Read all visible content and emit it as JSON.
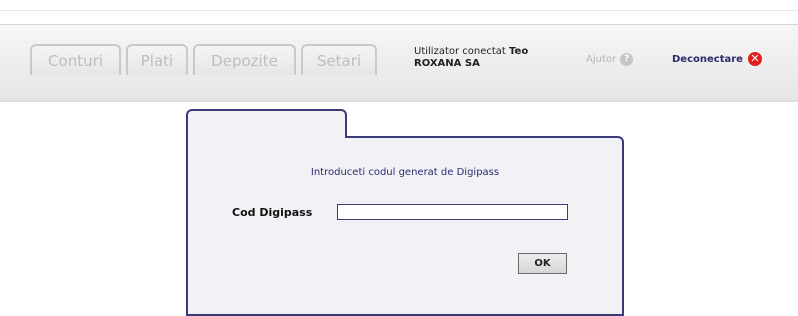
{
  "header": {
    "tabs": [
      {
        "label": "Conturi"
      },
      {
        "label": "Plati"
      },
      {
        "label": "Depozite"
      },
      {
        "label": "Setari"
      }
    ],
    "user_prefix": "Utilizator conectat",
    "user_name": "Teo",
    "user_company": "ROXANA SA",
    "help_label": "Ajutor",
    "help_icon": "help-icon",
    "logout_label": "Deconectare",
    "logout_icon": "close-icon"
  },
  "dialog": {
    "instruction": "Introduceti codul generat de Digipass",
    "field_label": "Cod Digipass",
    "field_value": "",
    "ok_label": "OK"
  },
  "colors": {
    "accent_navy": "#3a3b78",
    "logout_red": "#e0201c",
    "panel_bg": "#f1f1f6"
  }
}
